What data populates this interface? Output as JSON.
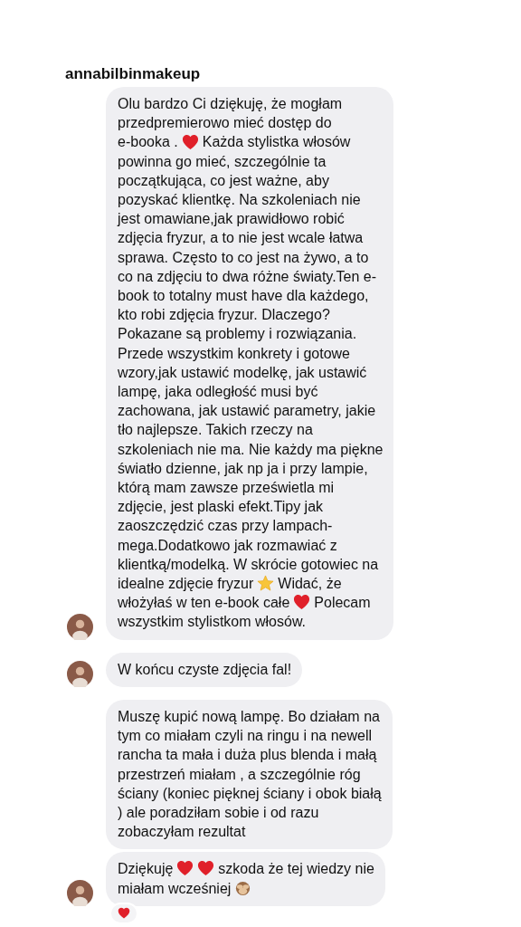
{
  "sender": "annabilbinmakeup",
  "messages": [
    {
      "show_avatar": true,
      "reacted": false,
      "lines": [
        [
          "Olu bardzo Ci dziękuję, że mogłam"
        ],
        [
          "przedpremierowo mieć dostęp do"
        ],
        [
          "e-booka .",
          {
            "kind": "heart"
          },
          "Każda stylistka włosów"
        ],
        [
          "powinna go mieć, szczególnie ta"
        ],
        [
          "początkująca, co jest ważne, aby"
        ],
        [
          "pozyskać klientkę. Na szkoleniach nie"
        ],
        [
          "jest omawiane,jak prawidłowo robić"
        ],
        [
          "zdjęcia fryzur, a to nie jest wcale łatwa"
        ],
        [
          "sprawa. Często to co jest na żywo, a to"
        ],
        [
          "co na zdjęciu to dwa różne światy.Ten e-"
        ],
        [
          "book to totalny must have dla każdego,"
        ],
        [
          "kto robi zdjęcia fryzur. Dlaczego?"
        ],
        [
          "Pokazane są problemy i rozwiązania."
        ],
        [
          "Przede wszystkim konkrety i gotowe"
        ],
        [
          "wzory,jak ustawić modelkę, jak ustawić"
        ],
        [
          "lampę, jaka odległość musi być"
        ],
        [
          "zachowana, jak ustawić parametry, jakie"
        ],
        [
          "tło najlepsze. Takich rzeczy na"
        ],
        [
          "szkoleniach nie ma. Nie każdy ma piękne"
        ],
        [
          "światło dzienne, jak np ja i przy lampie,"
        ],
        [
          "którą mam zawsze prześwietla mi"
        ],
        [
          "zdjęcie, jest plaski efekt.Tipy jak"
        ],
        [
          "zaoszczędzić czas przy lampach-"
        ],
        [
          "mega.Dodatkowo jak rozmawiać z"
        ],
        [
          "klientką/modelką. W skrócie gotowiec na"
        ],
        [
          "idealne zdjęcie fryzur",
          {
            "kind": "star"
          },
          "Widać, że"
        ],
        [
          "włożyłaś w ten e-book całe",
          {
            "kind": "heart"
          },
          "Polecam"
        ],
        [
          "wszystkim stylistkom włosów."
        ]
      ]
    },
    {
      "show_avatar": true,
      "reacted": false,
      "lines": [
        [
          "W końcu czyste zdjęcia fal!"
        ]
      ]
    },
    {
      "show_avatar": false,
      "reacted": false,
      "lines": [
        [
          "Muszę kupić nową lampę. Bo działam na"
        ],
        [
          "tym co miałam czyli na ringu i na newell"
        ],
        [
          "rancha ta mała i duża plus blenda i małą"
        ],
        [
          "przestrzeń miałam , a szczególnie róg"
        ],
        [
          "ściany (koniec pięknej ściany i obok białą"
        ],
        [
          ") ale poradziłam sobie i od razu"
        ],
        [
          "zobaczyłam rezultat"
        ]
      ]
    },
    {
      "show_avatar": true,
      "reacted": true,
      "lines": [
        [
          "Dziękuję",
          {
            "kind": "heart"
          },
          {
            "kind": "heart"
          },
          "szkoda że tej wiedzy nie"
        ],
        [
          "miałam wcześniej",
          {
            "kind": "monkey"
          }
        ]
      ]
    }
  ]
}
